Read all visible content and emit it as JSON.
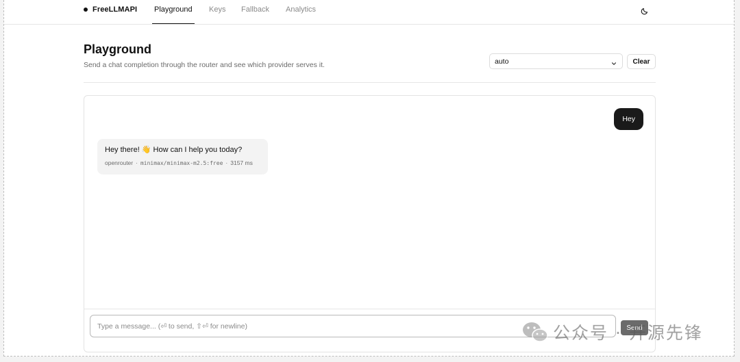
{
  "app": {
    "brand": "FreeLLMAPI"
  },
  "nav": {
    "tabs": [
      {
        "label": "Playground",
        "active": true
      },
      {
        "label": "Keys",
        "active": false
      },
      {
        "label": "Fallback",
        "active": false
      },
      {
        "label": "Analytics",
        "active": false
      }
    ],
    "theme_icon": "moon-icon"
  },
  "header": {
    "title": "Playground",
    "subtitle": "Send a chat completion through the router and see which provider serves it.",
    "model_select": {
      "value": "auto"
    },
    "clear_label": "Clear"
  },
  "chat": {
    "messages": [
      {
        "role": "user",
        "text": "Hey"
      },
      {
        "role": "assistant",
        "text": "Hey there! 👋 How can I help you today?",
        "provider": "openrouter",
        "model": "minimax/minimax-m2.5:free",
        "latency": "3157 ms"
      }
    ]
  },
  "composer": {
    "placeholder": "Type a message... (⏎ to send, ⇧⏎ for newline)",
    "send_label": "Send"
  },
  "watermark": {
    "text": "公众号 · 开源先锋"
  },
  "colors": {
    "accent": "#111111",
    "user_bubble": "#1a1a1a",
    "assistant_bubble": "#f3f3f3",
    "send_button": "#6b6b6b"
  }
}
